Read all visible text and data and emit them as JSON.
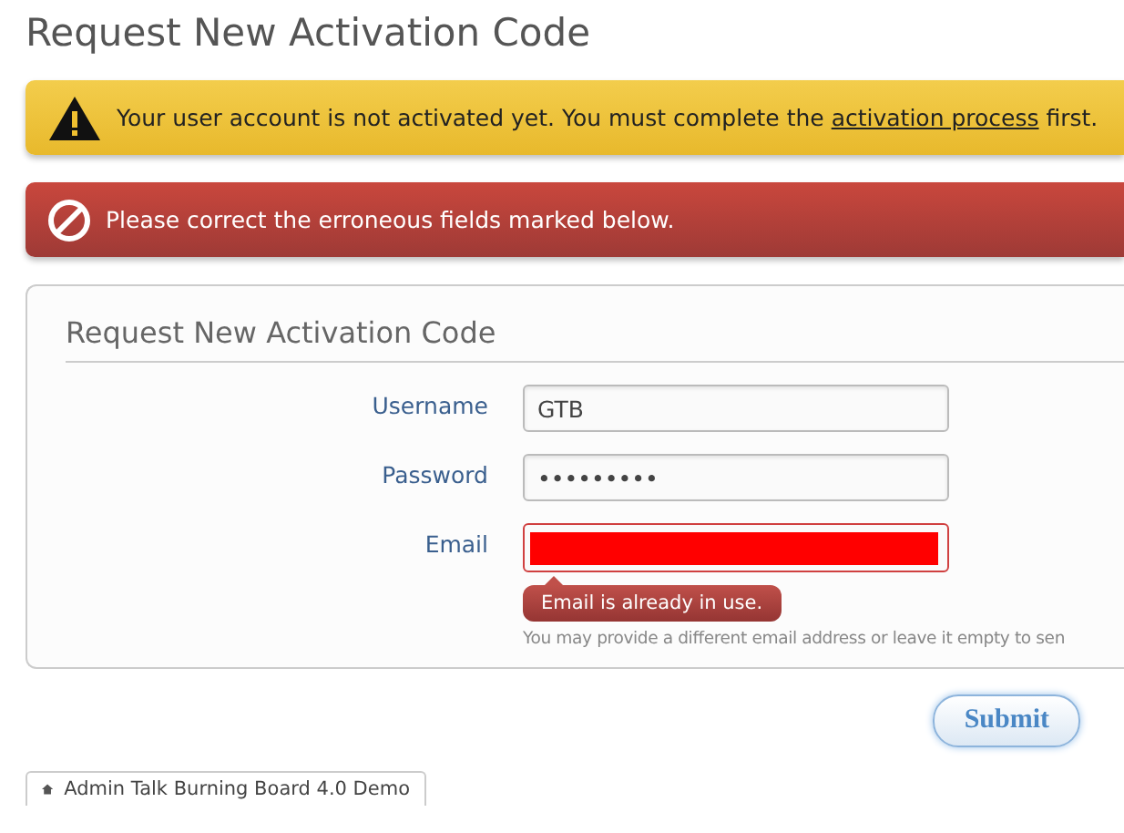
{
  "page_title": "Request New Activation Code",
  "warning": {
    "text_before": "Your user account is not activated yet. You must complete the",
    "link": "activation process",
    "text_after": "first."
  },
  "error": {
    "text": "Please correct the erroneous fields marked below."
  },
  "form": {
    "title": "Request New Activation Code",
    "fields": [
      {
        "label": "Username",
        "kind": "text",
        "value": "GTB",
        "has_error": false
      },
      {
        "label": "Password",
        "kind": "password",
        "value": "•••••••••",
        "has_error": false
      },
      {
        "label": "Email",
        "kind": "redacted",
        "has_error": true,
        "error": "Email is already in use.",
        "help": "You may provide a different email address or leave it empty to sen"
      }
    ]
  },
  "submit": "Submit",
  "breadcrumb": "Admin Talk Burning Board 4.0 Demo"
}
